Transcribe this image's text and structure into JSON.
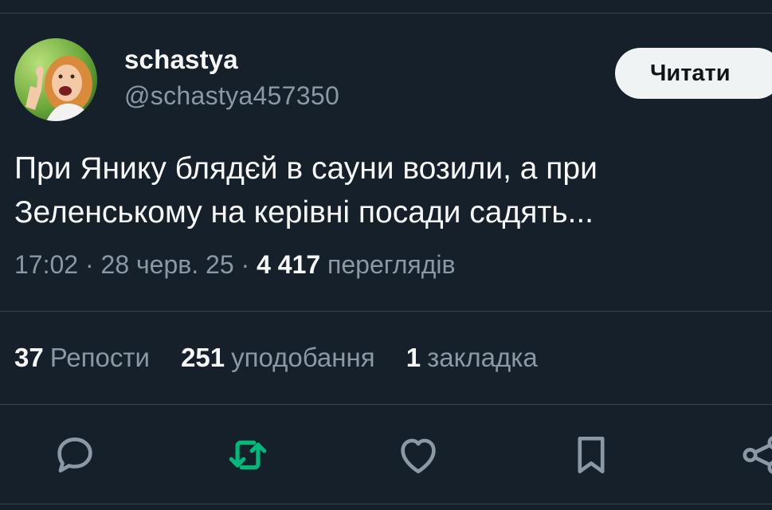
{
  "author": {
    "display_name": "schastya",
    "handle": "@schastya457350"
  },
  "follow_button": {
    "label": "Читати"
  },
  "tweet": {
    "text": "При Янику блядєй в сауни возили, а при\nЗеленському на керівні посади садять..."
  },
  "meta": {
    "time": "17:02",
    "separator": "·",
    "date": "28 черв. 25",
    "views_count": "4 417",
    "views_label": "переглядів"
  },
  "stats": {
    "reposts_count": "37",
    "reposts_label": "Репости",
    "likes_count": "251",
    "likes_label": "уподобання",
    "bookmarks_count": "1",
    "bookmarks_label": "закладка"
  },
  "actions": {
    "icons": [
      "reply-icon",
      "retweet-icon",
      "like-icon",
      "bookmark-icon",
      "share-icon"
    ],
    "retweet_color": "#00ba7c",
    "default_color": "#8b98a5"
  },
  "colors": {
    "background": "#15202b",
    "divider": "#38444d",
    "text_primary": "#f7f9f9",
    "text_secondary": "#8b98a5"
  }
}
